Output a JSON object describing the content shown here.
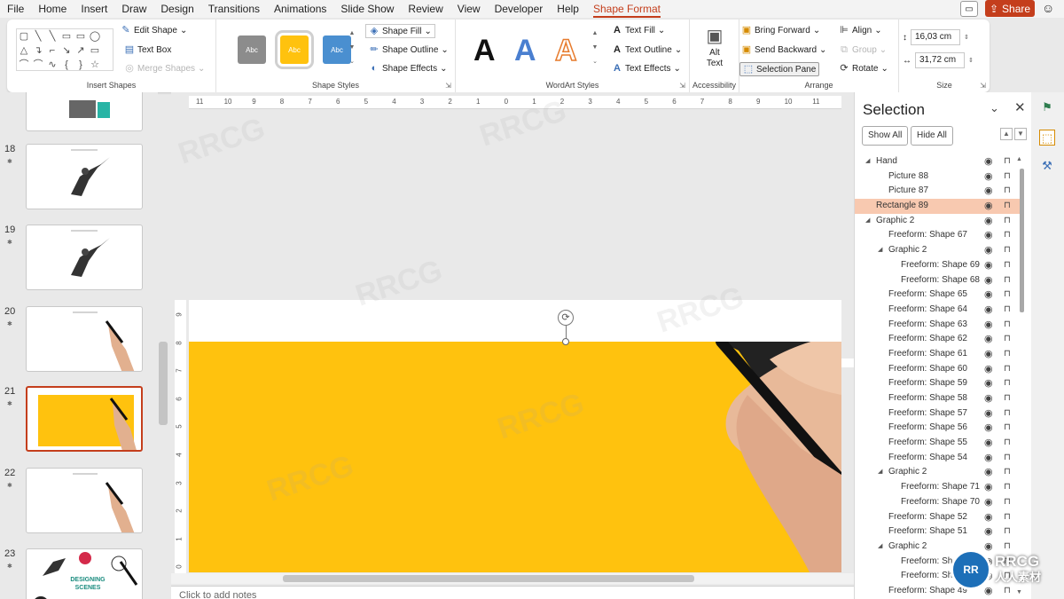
{
  "menu": {
    "items": [
      "File",
      "Home",
      "Insert",
      "Draw",
      "Design",
      "Transitions",
      "Animations",
      "Slide Show",
      "Review",
      "View",
      "Developer",
      "Help",
      "Shape Format"
    ],
    "active": "Shape Format",
    "share_label": "Share"
  },
  "ribbon": {
    "insert_shapes": {
      "edit_shape": "Edit Shape",
      "text_box": "Text Box",
      "merge_shapes": "Merge Shapes",
      "label": "Insert Shapes",
      "shape_glyphs": [
        "▢",
        "╲",
        "╲",
        "▭",
        "▭",
        "◯",
        "△",
        "↴",
        "⌐",
        "↘",
        "↗",
        "▭",
        "⌒",
        "⌒",
        "∿",
        "{",
        "}",
        "☆"
      ]
    },
    "shape_styles": {
      "swatches": [
        {
          "text": "Abc",
          "color": "#8c8c8c"
        },
        {
          "text": "Abc",
          "color": "#ffc20e"
        },
        {
          "text": "Abc",
          "color": "#4a8fd0"
        }
      ],
      "shape_fill": "Shape Fill",
      "shape_outline": "Shape Outline",
      "shape_effects": "Shape Effects",
      "label": "Shape Styles"
    },
    "wordart": {
      "letters": [
        {
          "char": "A",
          "style": "black"
        },
        {
          "char": "A",
          "style": "blue"
        },
        {
          "char": "A",
          "style": "orange"
        }
      ],
      "text_fill": "Text Fill",
      "text_outline": "Text Outline",
      "text_effects": "Text Effects",
      "label": "WordArt Styles"
    },
    "accessibility": {
      "alt_text_line1": "Alt",
      "alt_text_line2": "Text",
      "label": "Accessibility"
    },
    "arrange": {
      "bring_forward": "Bring Forward",
      "send_backward": "Send Backward",
      "selection_pane": "Selection Pane",
      "align": "Align",
      "group": "Group",
      "rotate": "Rotate",
      "label": "Arrange"
    },
    "size": {
      "height": "16,03 cm",
      "width": "31,72 cm",
      "label": "Size"
    }
  },
  "slides": [
    {
      "number": "18",
      "kind": "hero"
    },
    {
      "number": "19",
      "kind": "hero"
    },
    {
      "number": "20",
      "kind": "hand"
    },
    {
      "number": "21",
      "kind": "yellow",
      "selected": true
    },
    {
      "number": "22",
      "kind": "hand"
    },
    {
      "number": "23",
      "kind": "designing",
      "caption": "DESIGNING SCENES"
    }
  ],
  "ruler": {
    "horizontal": [
      "11",
      "10",
      "9",
      "8",
      "7",
      "6",
      "5",
      "4",
      "3",
      "2",
      "1",
      "0",
      "1",
      "2",
      "3",
      "4",
      "5",
      "6",
      "7",
      "8",
      "9",
      "10",
      "11"
    ],
    "vertical": [
      "9",
      "8",
      "7",
      "6",
      "5",
      "4",
      "3",
      "2",
      "1",
      "0"
    ]
  },
  "slide": {
    "rect_color": "#ffc20e"
  },
  "notes_placeholder": "Click to add notes",
  "selection_pane": {
    "title": "Selection",
    "show_all": "Show All",
    "hide_all": "Hide All",
    "items": [
      {
        "label": "Hand",
        "indent": 0,
        "expanded": true
      },
      {
        "label": "Picture 88",
        "indent": 1
      },
      {
        "label": "Picture 87",
        "indent": 1
      },
      {
        "label": "Rectangle 89",
        "indent": 0,
        "highlighted": true
      },
      {
        "label": "Graphic 2",
        "indent": 0,
        "expanded": true
      },
      {
        "label": "Freeform: Shape 67",
        "indent": 1
      },
      {
        "label": "Graphic 2",
        "indent": 1,
        "expanded": true
      },
      {
        "label": "Freeform: Shape 69",
        "indent": 2
      },
      {
        "label": "Freeform: Shape 68",
        "indent": 2
      },
      {
        "label": "Freeform: Shape 65",
        "indent": 1
      },
      {
        "label": "Freeform: Shape 64",
        "indent": 1
      },
      {
        "label": "Freeform: Shape 63",
        "indent": 1
      },
      {
        "label": "Freeform: Shape 62",
        "indent": 1
      },
      {
        "label": "Freeform: Shape 61",
        "indent": 1
      },
      {
        "label": "Freeform: Shape 60",
        "indent": 1
      },
      {
        "label": "Freeform: Shape 59",
        "indent": 1
      },
      {
        "label": "Freeform: Shape 58",
        "indent": 1
      },
      {
        "label": "Freeform: Shape 57",
        "indent": 1
      },
      {
        "label": "Freeform: Shape 56",
        "indent": 1
      },
      {
        "label": "Freeform: Shape 55",
        "indent": 1
      },
      {
        "label": "Freeform: Shape 54",
        "indent": 1
      },
      {
        "label": "Graphic 2",
        "indent": 1,
        "expanded": true
      },
      {
        "label": "Freeform: Shape 71",
        "indent": 2
      },
      {
        "label": "Freeform: Shape 70",
        "indent": 2
      },
      {
        "label": "Freeform: Shape 52",
        "indent": 1
      },
      {
        "label": "Freeform: Shape 51",
        "indent": 1
      },
      {
        "label": "Graphic 2",
        "indent": 1,
        "expanded": true
      },
      {
        "label": "Freeform: Sha",
        "indent": 2
      },
      {
        "label": "Freeform: Sha",
        "indent": 2
      },
      {
        "label": "Freeform: Shape 49",
        "indent": 1
      }
    ]
  },
  "watermark": {
    "text": "RRCG",
    "logo_line1": "RRCG",
    "logo_line2": "人人素材"
  }
}
